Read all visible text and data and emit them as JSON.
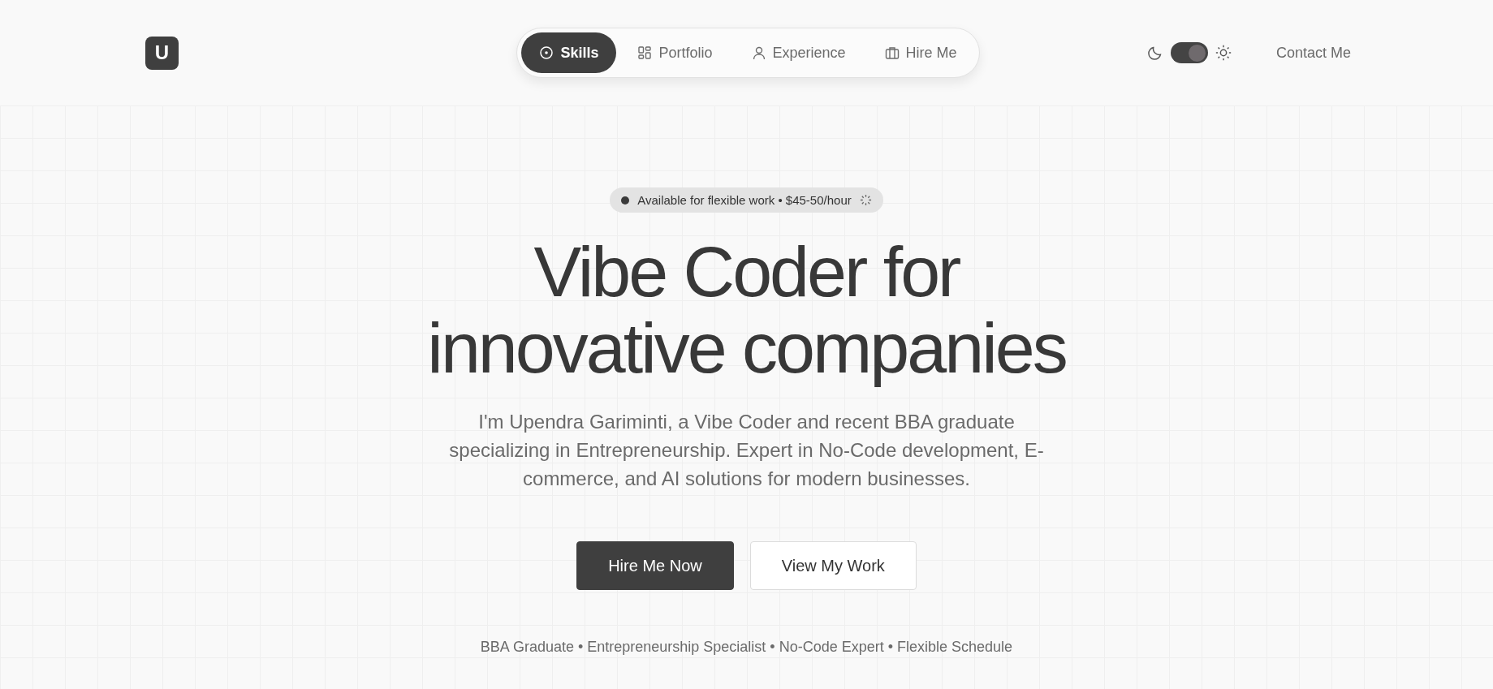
{
  "logo": {
    "letter": "U"
  },
  "nav": [
    {
      "label": "Skills",
      "selected": true
    },
    {
      "label": "Portfolio",
      "selected": false
    },
    {
      "label": "Experience",
      "selected": false
    },
    {
      "label": "Hire Me",
      "selected": false
    }
  ],
  "theme_toggle": {
    "on": true
  },
  "contact_link": "Contact Me",
  "hero": {
    "badge": "Available for flexible work • $45-50/hour",
    "heading_lines": [
      "Vibe Coder for",
      "innovative companies"
    ],
    "intro": "I'm Upendra Gariminti, a Vibe Coder and recent BBA graduate specializing in Entrepreneurship. Expert in No-Code development, E-commerce, and AI solutions for modern businesses.",
    "buttons": [
      {
        "label": "Hire Me Now",
        "kind": "primary"
      },
      {
        "label": "View My Work",
        "kind": "secondary"
      }
    ],
    "highlights": "BBA Graduate • Entrepreneurship Specialist • No-Code Expert • Flexible Schedule"
  }
}
